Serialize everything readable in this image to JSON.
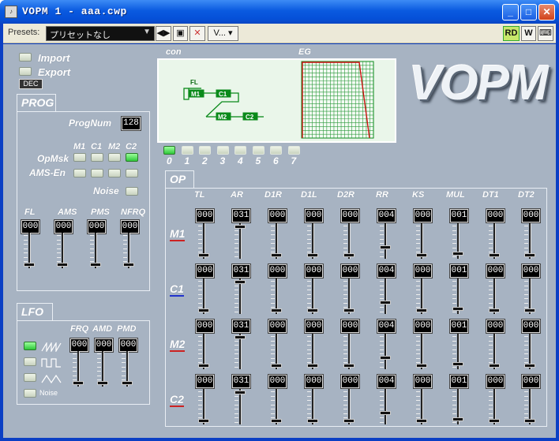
{
  "window": {
    "title": "VOPM 1 - aaa.cwp",
    "icon": "app-icon"
  },
  "toolbar": {
    "presets_label": "Presets:",
    "preset_value": "プリセットなし",
    "v_menu": "V...",
    "rd": "RD",
    "w": "W"
  },
  "file": {
    "import": "Import",
    "export": "Export",
    "dec": "DEC"
  },
  "prog": {
    "tab": "PROG",
    "prognum_label": "ProgNum",
    "prognum": "128",
    "opmsk_label": "OpMsk",
    "ams_en_label": "AMS-En",
    "noise_label": "Noise",
    "op_headers": [
      "M1",
      "C1",
      "M2",
      "C2"
    ],
    "opmsk": [
      false,
      false,
      false,
      true
    ],
    "ams_en": [
      false,
      false,
      false,
      false
    ],
    "noise": false,
    "params": [
      {
        "label": "FL",
        "value": "000",
        "level": 0
      },
      {
        "label": "AMS",
        "value": "000",
        "level": 0
      },
      {
        "label": "PMS",
        "value": "000",
        "level": 0
      },
      {
        "label": "NFRQ",
        "value": "000",
        "level": 0
      }
    ]
  },
  "lfo": {
    "tab": "LFO",
    "waves": [
      {
        "icon": "saw-wave-icon",
        "active": true
      },
      {
        "icon": "square-wave-icon",
        "active": false
      },
      {
        "icon": "triangle-wave-icon",
        "active": false
      },
      {
        "label": "Noise",
        "active": false
      }
    ],
    "params": [
      {
        "label": "FRQ",
        "value": "000",
        "level": 0
      },
      {
        "label": "AMD",
        "value": "000",
        "level": 0
      },
      {
        "label": "PMD",
        "value": "000",
        "level": 0
      }
    ]
  },
  "display": {
    "con_label": "con",
    "eg_label": "EG",
    "algo_nodes": {
      "fl": "FL",
      "m1": "M1",
      "c1": "C1",
      "m2": "M2",
      "c2": "C2"
    }
  },
  "algorithms": {
    "labels": [
      "0",
      "1",
      "2",
      "3",
      "4",
      "5",
      "6",
      "7"
    ],
    "selected": 0
  },
  "op": {
    "tab": "OP",
    "headers": [
      "TL",
      "AR",
      "D1R",
      "D1L",
      "D2R",
      "RR",
      "KS",
      "MUL",
      "DT1",
      "DT2"
    ],
    "rows": [
      {
        "name": "M1",
        "color": "#cc2222",
        "values": [
          "000",
          "031",
          "000",
          "000",
          "000",
          "004",
          "000",
          "001",
          "000",
          "000"
        ]
      },
      {
        "name": "C1",
        "color": "#2233cc",
        "values": [
          "000",
          "031",
          "000",
          "000",
          "000",
          "004",
          "000",
          "001",
          "000",
          "000"
        ]
      },
      {
        "name": "M2",
        "color": "#cc2222",
        "values": [
          "000",
          "031",
          "000",
          "000",
          "000",
          "004",
          "000",
          "001",
          "000",
          "000"
        ]
      },
      {
        "name": "C2",
        "color": "#cc2222",
        "values": [
          "000",
          "031",
          "000",
          "000",
          "000",
          "004",
          "000",
          "001",
          "000",
          "000"
        ]
      }
    ],
    "maxes": [
      127,
      31,
      31,
      15,
      31,
      15,
      3,
      15,
      7,
      3
    ]
  },
  "logo": "VOPM"
}
